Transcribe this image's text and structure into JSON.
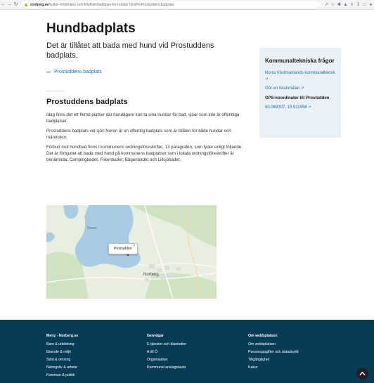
{
  "browser": {
    "url_domain": "norberg.se",
    "url_path": "/kultur--fritid/natur-och-friluftsliv/badplats-for-hundar.html#h-Prostuddensbadplats"
  },
  "page": {
    "title": "Hundbadplats",
    "lead": "Det är tillåtet att bada med hund vid Prostuddens badplats.",
    "anchor_link": "Prostuddens badplats",
    "section_title": "Prostuddens badplats",
    "paragraphs": [
      "Idag finns det ett flertal platser där hundägare kan ta sina hundar för bad, sjöar som inte är offentliga badplatser.",
      "Prostuddens badplats vid sjön Noren är en offentlig badplats som är tillåten för både hundar och människor.",
      "Förbud mot hundbad finns i kommunens ordningsföreskrifter, 13 paragrafen, som lyder enligt följande: Det är förbjudet att bada med hund på kommunens badplatser som i lokala ordningsföreskrifter är benämnda: Campingbadet, Flikenbadet, Bågenbadet och Lillsjöbadet."
    ]
  },
  "sidebar": {
    "title": "Kommunaltekniska frågor",
    "link1": "Norra Västmanlands kommunalteknik",
    "link2": "Gör en felanmälan",
    "gps_label": "GPS-koordinater till Prostudden",
    "gps_value": "60.069307, 15.911958"
  },
  "map": {
    "popup_label": "Prostudden",
    "labels": {
      "town": "Norberg",
      "lake": "Noren"
    }
  },
  "footer": {
    "col1": {
      "heading": "Meny - Norberg.se",
      "items": [
        "Barn & utbildning",
        "Boende & miljö",
        "Stöd & omsorg",
        "Näringsliv & arbete",
        "Kommun & politik"
      ]
    },
    "col2": {
      "heading": "Genvägar",
      "items": [
        "E-tjänster och blanketter",
        "A till Ö",
        "Organisation",
        "Kommunal anslagstavla"
      ]
    },
    "col3": {
      "heading": "Om webbplatsen",
      "items": [
        "Om webbplatsen",
        "Personuppgifter och dataskydd",
        "Tillgänglighet",
        "Kakor"
      ]
    }
  },
  "colors": {
    "link": "#1f6fa8",
    "footer_bg": "#073b56",
    "sidebar_bg": "#e9f1f6",
    "map_water": "#a9cbe3",
    "map_forest": "#cfe3c3"
  },
  "icons": [
    "back-icon",
    "forward-icon",
    "reload-icon",
    "lock-icon",
    "external-link-icon",
    "close-icon",
    "arrow-up-icon"
  ]
}
